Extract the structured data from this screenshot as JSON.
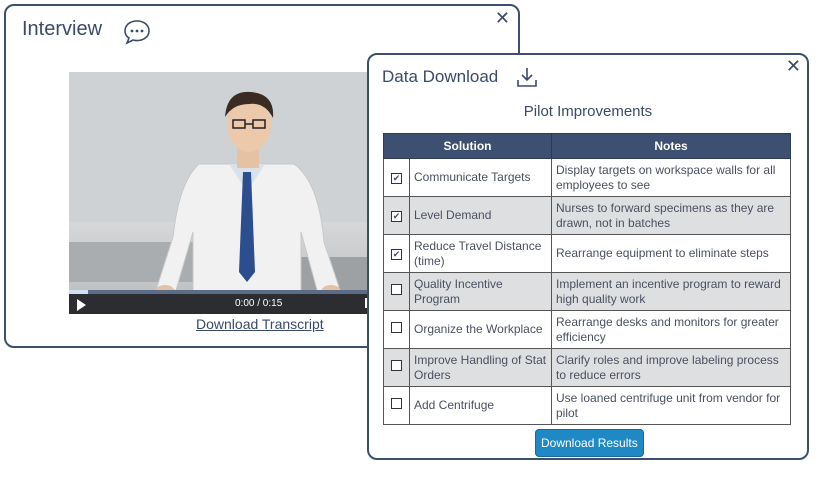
{
  "interview": {
    "title": "Interview",
    "close": "✕",
    "video": {
      "time": "0:00 / 0:15",
      "progress": 0.06
    },
    "transcript_link": "Download Transcript"
  },
  "download": {
    "title": "Data Download",
    "close": "✕",
    "subtitle": "Pilot Improvements",
    "columns": [
      "Solution",
      "Notes"
    ],
    "rows": [
      {
        "checked": true,
        "solution": "Communicate Targets",
        "notes": "Display targets on workspace walls for all employees to see"
      },
      {
        "checked": true,
        "solution": "Level Demand",
        "notes": "Nurses to forward specimens as they are drawn, not in batches"
      },
      {
        "checked": true,
        "solution": "Reduce Travel Distance (time)",
        "notes": "Rearrange equipment to eliminate steps"
      },
      {
        "checked": false,
        "solution": "Quality Incentive Program",
        "notes": "Implement an incentive program to reward high quality work"
      },
      {
        "checked": false,
        "solution": "Organize the Workplace",
        "notes": "Rearrange desks and monitors for greater efficiency"
      },
      {
        "checked": false,
        "solution": "Improve Handling of Stat Orders",
        "notes": "Clarify roles and improve labeling process to reduce errors"
      },
      {
        "checked": false,
        "solution": "Add Centrifuge",
        "notes": "Use loaned centrifuge unit from vendor for pilot"
      }
    ],
    "button": "Download Results"
  },
  "colors": {
    "header": "#3e5071",
    "border": "#3e4f6e",
    "button": "#1f89c6"
  },
  "icons": {
    "interview": "chat-bubble-icon",
    "download": "download-icon"
  }
}
